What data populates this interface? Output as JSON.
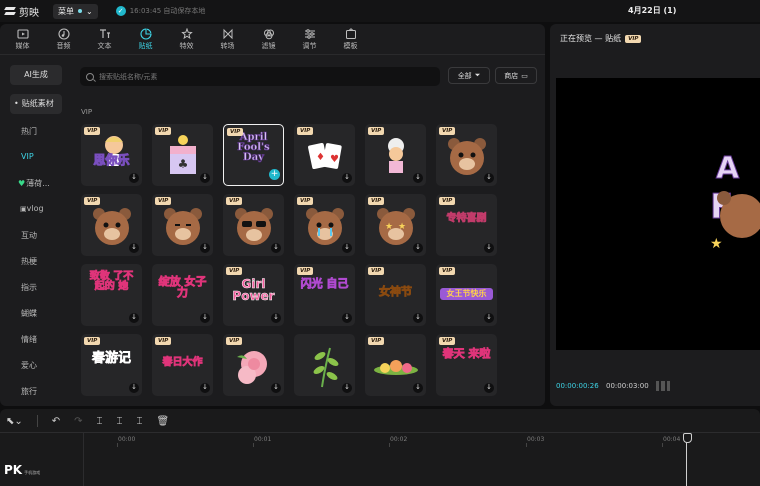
{
  "app": {
    "name": "剪映",
    "menu_label": "菜单",
    "save_status": "16:03:45 自动保存本地",
    "project_title": "4月22日 (1)"
  },
  "toolbar": [
    {
      "label": "媒体",
      "icon": "media-icon"
    },
    {
      "label": "音频",
      "icon": "audio-icon"
    },
    {
      "label": "文本",
      "icon": "text-icon"
    },
    {
      "label": "贴纸",
      "icon": "sticker-icon",
      "active": true
    },
    {
      "label": "特效",
      "icon": "effects-icon"
    },
    {
      "label": "转场",
      "icon": "transition-icon"
    },
    {
      "label": "滤镜",
      "icon": "filter-icon"
    },
    {
      "label": "调节",
      "icon": "adjust-icon"
    },
    {
      "label": "模板",
      "icon": "template-icon"
    }
  ],
  "sidebar": {
    "ai_label": "AI生成",
    "material_label": "贴纸素材",
    "categories": [
      "热门",
      "VIP",
      "薄荷...",
      "vlog",
      "互动",
      "热梗",
      "指示",
      "蝴蝶",
      "情绪",
      "爱心",
      "旅行"
    ]
  },
  "search": {
    "placeholder": "搜索贴纸名称/元素"
  },
  "filter": {
    "all_label": "全部",
    "store_label": "商店"
  },
  "section": {
    "label": "VIP"
  },
  "stickers": {
    "vip_badge": "VIP",
    "texts": {
      "r1c1": "思你乐",
      "r1c3": "April Fool's Day",
      "r2c6": "专特喜剧",
      "r3c1": "致敬 了不起的 她",
      "r3c2": "绽放 女子力",
      "r3c3": "Girl Power",
      "r3c4": "闪光 自己",
      "r3c5": "女神节",
      "r3c6": "女王节快乐",
      "r4c1": "春游记",
      "r4c2": "春日大作",
      "r4c6": "春天 来啦"
    }
  },
  "preview": {
    "title": "正在预览 — 贴纸",
    "vip": "VIP",
    "current_time": "00:00:00:26",
    "total_time": "00:00:03:00"
  },
  "timeline": {
    "ticks": [
      "00:00",
      "00:01",
      "00:02",
      "00:03",
      "00:04"
    ]
  },
  "watermark": {
    "text": "PK",
    "sub": "手机游戏"
  }
}
